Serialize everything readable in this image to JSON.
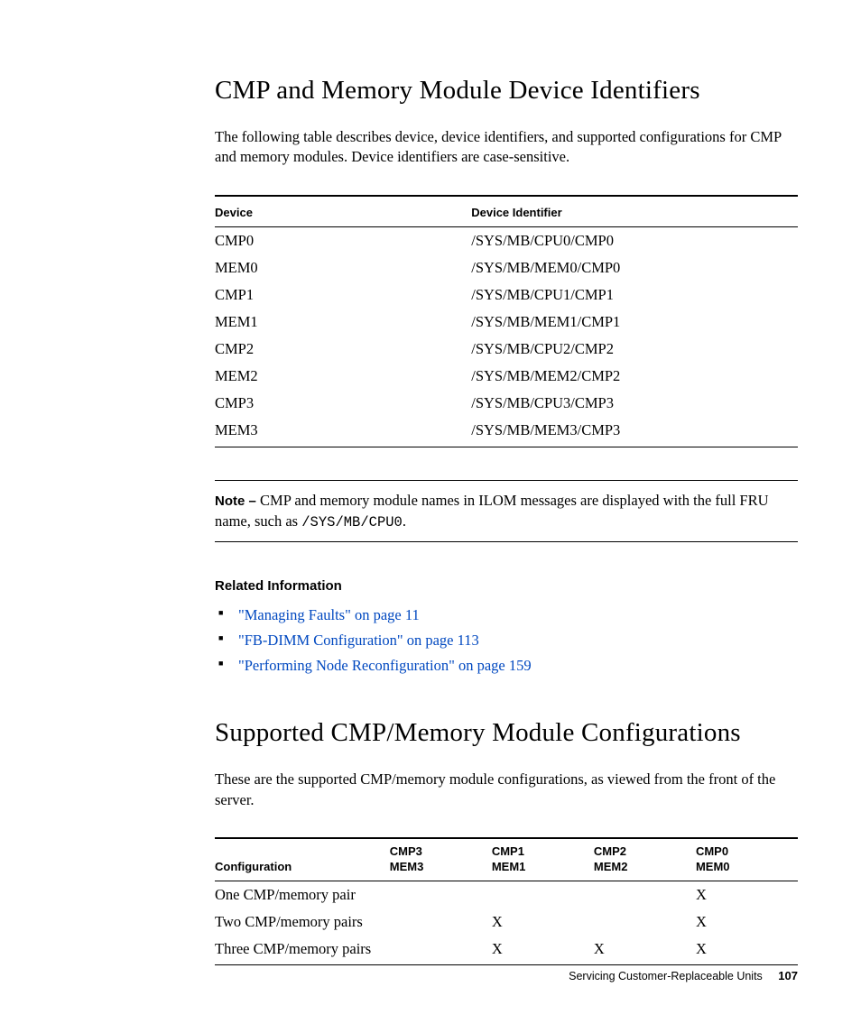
{
  "section1": {
    "title": "CMP and Memory Module Device Identifiers",
    "intro": "The following table describes device, device identifiers, and supported configurations for CMP and memory modules. Device identifiers are case-sensitive.",
    "table": {
      "head_device": "Device",
      "head_id": "Device Identifier",
      "rows": [
        {
          "device": "CMP0",
          "id": "/SYS/MB/CPU0/CMP0"
        },
        {
          "device": "MEM0",
          "id": "/SYS/MB/MEM0/CMP0"
        },
        {
          "device": "CMP1",
          "id": "/SYS/MB/CPU1/CMP1"
        },
        {
          "device": "MEM1",
          "id": "/SYS/MB/MEM1/CMP1"
        },
        {
          "device": "CMP2",
          "id": "/SYS/MB/CPU2/CMP2"
        },
        {
          "device": "MEM2",
          "id": "/SYS/MB/MEM2/CMP2"
        },
        {
          "device": "CMP3",
          "id": "/SYS/MB/CPU3/CMP3"
        },
        {
          "device": "MEM3",
          "id": "/SYS/MB/MEM3/CMP3"
        }
      ]
    },
    "note": {
      "label": "Note – ",
      "text_before": "CMP and memory module names in ILOM messages are displayed with the full FRU name, such as ",
      "code": "/SYS/MB/CPU0",
      "text_after": "."
    },
    "related": {
      "heading": "Related Information",
      "links": [
        "\"Managing Faults\" on page 11",
        "\"FB-DIMM Configuration\" on page 113",
        "\"Performing Node Reconfiguration\" on page 159"
      ]
    }
  },
  "section2": {
    "title": "Supported CMP/Memory Module Configurations",
    "intro": "These are the supported CMP/memory module configurations, as viewed from the front of the server.",
    "table": {
      "head": {
        "config": "Configuration",
        "c1a": "CMP3",
        "c1b": "MEM3",
        "c2a": "CMP1",
        "c2b": "MEM1",
        "c3a": "CMP2",
        "c3b": "MEM2",
        "c4a": "CMP0",
        "c4b": "MEM0"
      },
      "rows": [
        {
          "config": "One CMP/memory pair",
          "c1": "",
          "c2": "",
          "c3": "",
          "c4": "X"
        },
        {
          "config": "Two CMP/memory pairs",
          "c1": "",
          "c2": "X",
          "c3": "",
          "c4": "X"
        },
        {
          "config": "Three CMP/memory pairs",
          "c1": "",
          "c2": "X",
          "c3": "X",
          "c4": "X"
        }
      ]
    }
  },
  "footer": {
    "chapter": "Servicing Customer-Replaceable Units",
    "page": "107"
  }
}
